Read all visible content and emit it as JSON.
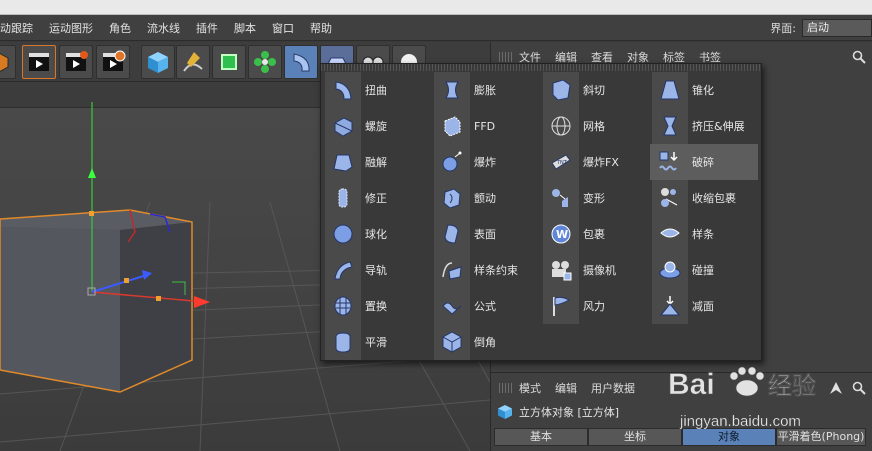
{
  "menubar": {
    "items": [
      "动跟踪",
      "运动图形",
      "角色",
      "流水线",
      "插件",
      "脚本",
      "窗口",
      "帮助"
    ],
    "layout_label": "界面:",
    "layout_value": "启动"
  },
  "toolbar": {
    "buttons": [
      "cube-object",
      "render-view",
      "render-to-picture-viewer",
      "render-settings",
      "cube",
      "pen-spline",
      "generator-subdivision",
      "cloner-array",
      "deformer-bend",
      "scene-floor",
      "camera",
      "light"
    ]
  },
  "object_manager": {
    "menu": [
      "文件",
      "编辑",
      "查看",
      "对象",
      "标签",
      "书签"
    ]
  },
  "deformer_menu": {
    "columns": [
      {
        "items": [
          {
            "label": "扭曲",
            "icon": "bend-icon"
          },
          {
            "label": "螺旋",
            "icon": "twist-icon"
          },
          {
            "label": "融解",
            "icon": "melt-icon"
          },
          {
            "label": "修正",
            "icon": "correction-icon"
          },
          {
            "label": "球化",
            "icon": "spherify-icon"
          },
          {
            "label": "导轨",
            "icon": "rail-icon"
          },
          {
            "label": "置换",
            "icon": "displacer-icon"
          },
          {
            "label": "平滑",
            "icon": "smoothing-icon"
          }
        ]
      },
      {
        "items": [
          {
            "label": "膨胀",
            "icon": "bulge-icon"
          },
          {
            "label": "FFD",
            "icon": "ffd-icon"
          },
          {
            "label": "爆炸",
            "icon": "explosion-icon"
          },
          {
            "label": "颤动",
            "icon": "jiggle-icon"
          },
          {
            "label": "表面",
            "icon": "surface-icon"
          },
          {
            "label": "样条约束",
            "icon": "spline-wrap-icon"
          },
          {
            "label": "公式",
            "icon": "formula-icon"
          },
          {
            "label": "倒角",
            "icon": "bevel-icon"
          }
        ]
      },
      {
        "items": [
          {
            "label": "斜切",
            "icon": "shear-icon"
          },
          {
            "label": "网格",
            "icon": "mesh-icon"
          },
          {
            "label": "爆炸FX",
            "icon": "explosion-fx-icon"
          },
          {
            "label": "变形",
            "icon": "morph-icon"
          },
          {
            "label": "包裹",
            "icon": "wrap-icon"
          },
          {
            "label": "摄像机",
            "icon": "camera-deformer-icon"
          },
          {
            "label": "风力",
            "icon": "wind-icon"
          }
        ]
      },
      {
        "items": [
          {
            "label": "锥化",
            "icon": "taper-icon"
          },
          {
            "label": "挤压&伸展",
            "icon": "squash-stretch-icon"
          },
          {
            "label": "破碎",
            "icon": "shatter-icon"
          },
          {
            "label": "收缩包裹",
            "icon": "shrink-wrap-icon"
          },
          {
            "label": "样条",
            "icon": "spline-deformer-icon"
          },
          {
            "label": "碰撞",
            "icon": "collision-icon"
          },
          {
            "label": "减面",
            "icon": "polygon-reduction-icon"
          }
        ]
      }
    ],
    "highlighted": "破碎"
  },
  "attribute_manager": {
    "menu": [
      "模式",
      "编辑",
      "用户数据"
    ],
    "object_label": "立方体对象 [立方体]",
    "tabs": [
      "基本",
      "坐标",
      "对象",
      "平滑着色(Phong)"
    ],
    "active_tab": "对象"
  },
  "watermark": {
    "brand": "Bai",
    "brand2": "经验",
    "url": "jingyan.baidu.com"
  },
  "colors": {
    "accent": "#5a82b8",
    "active_orange": "#d8772b",
    "cube_edge": "#e08a2a"
  }
}
